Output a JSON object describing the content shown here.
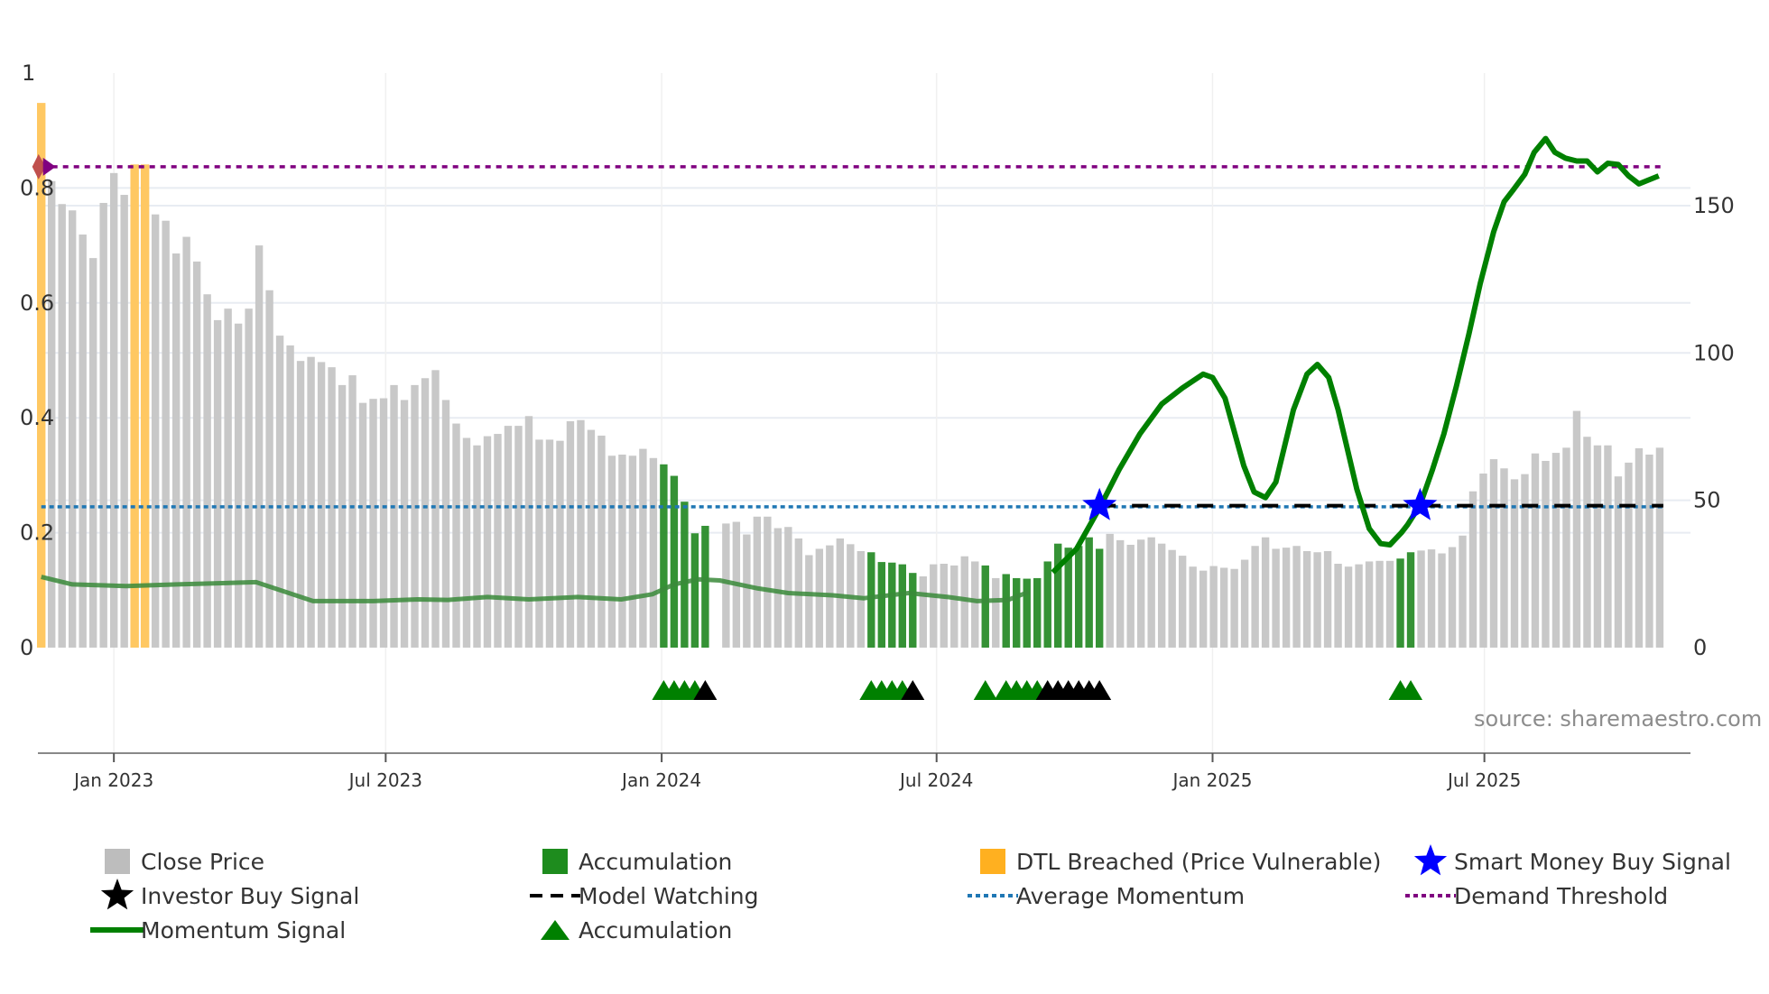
{
  "chart_data": {
    "type": "bar",
    "title": "",
    "xlabel": "",
    "ylabel": "",
    "y_left": {
      "lim": [
        0,
        1
      ],
      "ticks": [
        0,
        0.2,
        0.4,
        0.6,
        0.8,
        1
      ],
      "tick_labels": [
        "0",
        "0.2",
        "0.4",
        "0.6",
        "0.8",
        "1"
      ]
    },
    "y_right": {
      "lim": [
        0,
        195
      ],
      "ticks": [
        0,
        50,
        100,
        150
      ],
      "tick_labels": [
        "0",
        "50",
        "100",
        "150"
      ]
    },
    "x_ticks": [
      {
        "index": 7.0,
        "label": "Jan 2023"
      },
      {
        "index": 33.2,
        "label": "Jul 2023"
      },
      {
        "index": 59.8,
        "label": "Jan 2024"
      },
      {
        "index": 86.3,
        "label": "Jul 2024"
      },
      {
        "index": 112.9,
        "label": "Jan 2025"
      },
      {
        "index": 139.1,
        "label": "Jul 2025"
      }
    ],
    "grid": true,
    "close_price": [
      0.948,
      0.812,
      0.772,
      0.761,
      0.719,
      0.678,
      0.774,
      0.826,
      0.788,
      0.841,
      0.841,
      0.754,
      0.743,
      0.686,
      0.715,
      0.672,
      0.615,
      0.57,
      0.59,
      0.564,
      0.59,
      0.7,
      0.622,
      0.543,
      0.526,
      0.499,
      0.506,
      0.497,
      0.488,
      0.457,
      0.474,
      0.426,
      0.433,
      0.434,
      0.457,
      0.431,
      0.457,
      0.469,
      0.483,
      0.431,
      0.39,
      0.365,
      0.352,
      0.368,
      0.372,
      0.386,
      0.386,
      0.403,
      0.362,
      0.362,
      0.36,
      0.394,
      0.396,
      0.379,
      0.369,
      0.334,
      0.336,
      0.334,
      0.346,
      0.33,
      0.319,
      0.299,
      0.254,
      0.199,
      0.212,
      null,
      0.216,
      0.219,
      0.197,
      0.228,
      0.228,
      0.208,
      0.21,
      0.19,
      0.161,
      0.172,
      0.178,
      0.19,
      0.18,
      0.168,
      0.166,
      0.149,
      0.148,
      0.145,
      0.13,
      0.124,
      0.145,
      0.146,
      0.143,
      0.159,
      0.15,
      0.143,
      0.121,
      0.128,
      0.121,
      0.12,
      0.121,
      0.15,
      0.181,
      0.174,
      0.177,
      0.192,
      0.172,
      0.198,
      0.187,
      0.179,
      0.188,
      0.192,
      0.181,
      0.17,
      0.16,
      0.141,
      0.134,
      0.142,
      0.139,
      0.137,
      0.153,
      0.177,
      0.192,
      0.172,
      0.174,
      0.177,
      0.168,
      0.166,
      0.168,
      0.146,
      0.141,
      0.145,
      0.15,
      0.151,
      0.151,
      0.155,
      0.166,
      0.169,
      0.171,
      0.164,
      0.175,
      0.195,
      0.272,
      0.303,
      0.328,
      0.312,
      0.293,
      0.302,
      0.338,
      0.325,
      0.339,
      0.348,
      0.412,
      0.367,
      0.352,
      0.352,
      0.298,
      0.322,
      0.347,
      0.336,
      0.348
    ],
    "accumulation_indices": [
      60,
      61,
      62,
      63,
      64,
      80,
      81,
      82,
      83,
      84,
      91,
      93,
      94,
      95,
      96,
      97,
      98,
      99,
      100,
      101,
      102,
      131,
      132
    ],
    "dtl_breached_indices": [
      0,
      9,
      10
    ],
    "momentum_signal": [
      [
        0,
        0.123
      ],
      [
        3,
        0.11
      ],
      [
        8.2,
        0.107
      ],
      [
        13.1,
        0.11
      ],
      [
        20.7,
        0.114
      ],
      [
        26.2,
        0.081
      ],
      [
        32,
        0.081
      ],
      [
        36.3,
        0.084
      ],
      [
        39.2,
        0.083
      ],
      [
        43,
        0.088
      ],
      [
        47,
        0.084
      ],
      [
        51.7,
        0.088
      ],
      [
        55.9,
        0.084
      ],
      [
        58.9,
        0.093
      ],
      [
        61,
        0.11
      ],
      [
        63.3,
        0.119
      ],
      [
        65.4,
        0.117
      ],
      [
        69.1,
        0.103
      ],
      [
        72,
        0.095
      ],
      [
        76.3,
        0.091
      ],
      [
        79.3,
        0.086
      ],
      [
        83.6,
        0.095
      ],
      [
        87.4,
        0.088
      ],
      [
        90.2,
        0.081
      ],
      [
        93.2,
        0.083
      ],
      [
        95.2,
        0.097
      ],
      [
        97.5,
        0.131
      ],
      [
        99.8,
        0.172
      ],
      [
        102,
        0.243
      ],
      [
        103.9,
        0.31
      ],
      [
        105.9,
        0.372
      ],
      [
        108,
        0.424
      ],
      [
        110,
        0.452
      ],
      [
        112,
        0.476
      ],
      [
        112.9,
        0.47
      ],
      [
        114.1,
        0.434
      ],
      [
        115.9,
        0.317
      ],
      [
        116.9,
        0.271
      ],
      [
        118,
        0.261
      ],
      [
        119,
        0.288
      ],
      [
        120.7,
        0.414
      ],
      [
        122,
        0.476
      ],
      [
        123,
        0.493
      ],
      [
        124.1,
        0.47
      ],
      [
        125,
        0.414
      ],
      [
        126.8,
        0.276
      ],
      [
        128,
        0.207
      ],
      [
        129.1,
        0.181
      ],
      [
        130,
        0.179
      ],
      [
        131.1,
        0.2
      ],
      [
        131.7,
        0.214
      ],
      [
        132.9,
        0.248
      ],
      [
        134.1,
        0.31
      ],
      [
        135.2,
        0.372
      ],
      [
        136.4,
        0.455
      ],
      [
        137.6,
        0.545
      ],
      [
        138.7,
        0.634
      ],
      [
        140,
        0.724
      ],
      [
        141,
        0.776
      ],
      [
        141.9,
        0.797
      ],
      [
        143,
        0.824
      ],
      [
        143.9,
        0.862
      ],
      [
        145,
        0.886
      ],
      [
        145.9,
        0.862
      ],
      [
        146.9,
        0.852
      ],
      [
        148,
        0.847
      ],
      [
        149,
        0.847
      ],
      [
        150,
        0.828
      ],
      [
        151,
        0.843
      ],
      [
        152,
        0.841
      ],
      [
        153,
        0.821
      ],
      [
        154,
        0.807
      ],
      [
        155.9,
        0.821
      ]
    ],
    "momentum_emphasis_from_index": 96,
    "average_momentum": 0.245,
    "demand_threshold": 0.837,
    "model_watching": {
      "from_index": 102,
      "to_index": 156,
      "value": 0.247
    },
    "smart_money_buy_signals": [
      {
        "index": 102,
        "value": 0.247
      },
      {
        "index": 132.9,
        "value": 0.247
      }
    ],
    "accumulation_triangles": [
      60,
      61,
      62,
      63,
      80,
      81,
      82,
      83,
      91,
      93,
      94,
      95,
      96,
      131,
      132
    ],
    "investor_triangles": [
      64,
      84,
      97,
      98,
      99,
      100,
      101,
      102
    ],
    "legend_placement": "bottom",
    "legend": [
      {
        "label": "Close Price",
        "marker": "grey-square"
      },
      {
        "label": "Accumulation",
        "marker": "green-square"
      },
      {
        "label": "DTL Breached (Price Vulnerable)",
        "marker": "orange-square"
      },
      {
        "label": "Smart Money Buy Signal",
        "marker": "blue-star"
      },
      {
        "label": "Investor Buy Signal",
        "marker": "black-star"
      },
      {
        "label": "Model Watching",
        "marker": "black-dashed-line"
      },
      {
        "label": "Average Momentum",
        "marker": "blue-dotted-line"
      },
      {
        "label": "Demand Threshold",
        "marker": "purple-dotted-line"
      },
      {
        "label": "Momentum Signal",
        "marker": "green-line"
      },
      {
        "label": "Accumulation",
        "marker": "green-triangle"
      }
    ],
    "source": "source: sharemaestro.com"
  },
  "colors": {
    "close": "#c8c8c8",
    "accumulation": "#2a8c2a",
    "dtl": "#ffc862",
    "momentum": "#008000",
    "momentum_faded": "#3a8a3a",
    "smart_money": "#0000ff",
    "investor": "#000000",
    "average_momentum": "#1f77b4",
    "demand": "#800080",
    "grid": "#e8ecf2"
  }
}
